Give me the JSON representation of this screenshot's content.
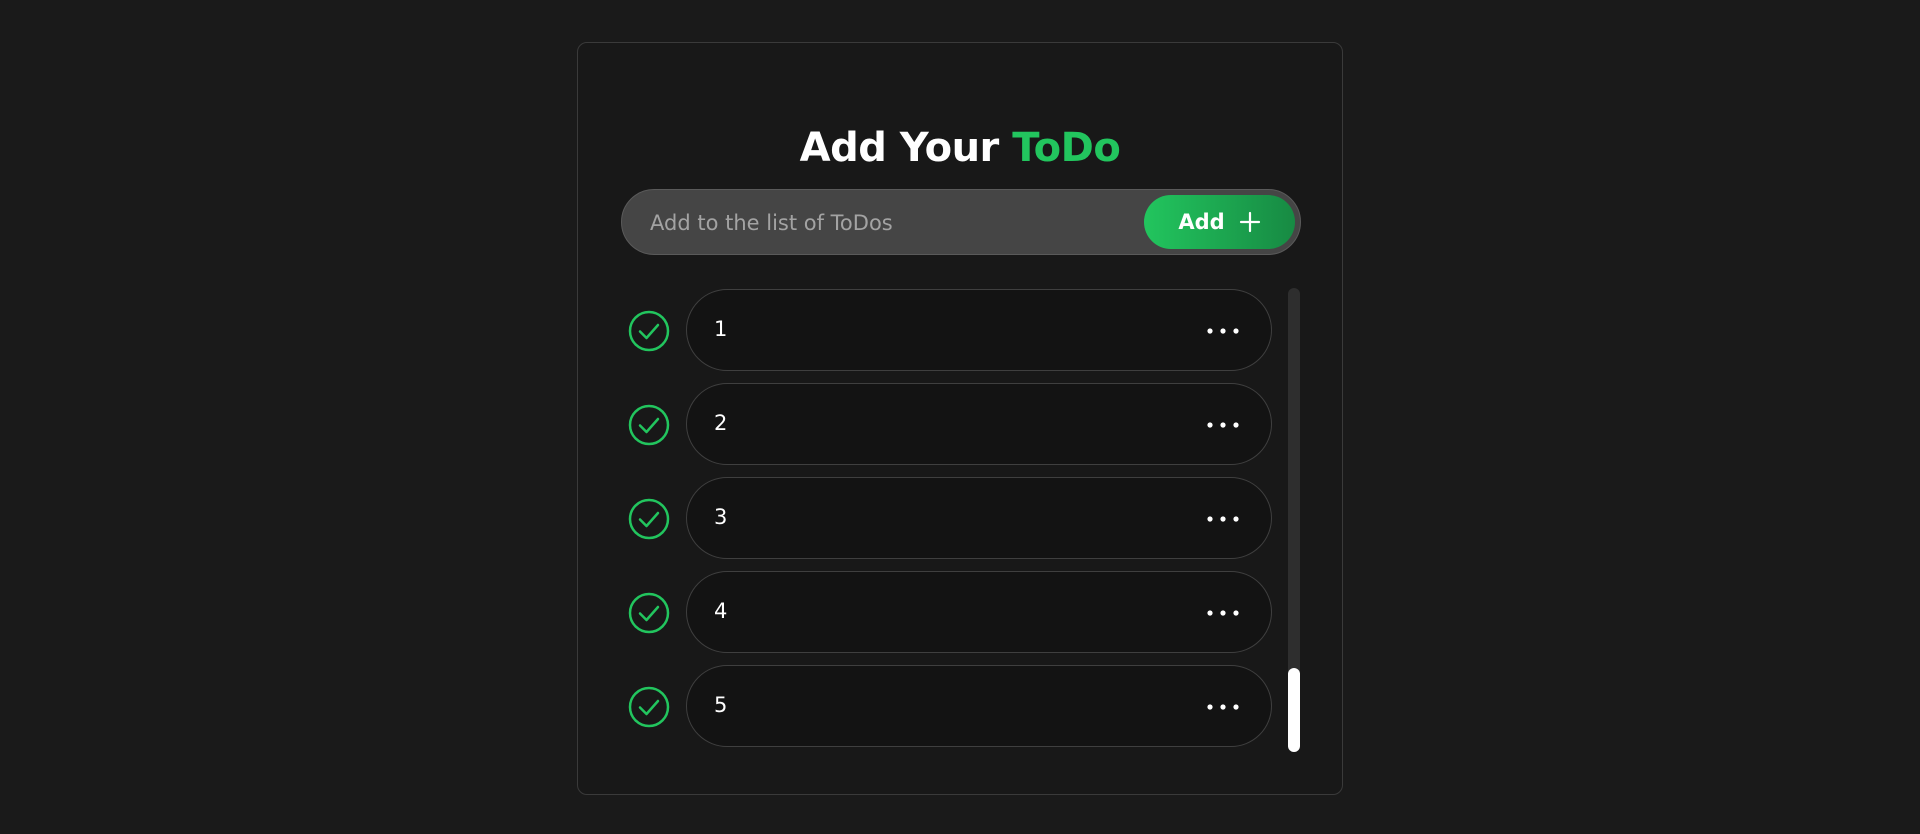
{
  "header": {
    "title_main": "Add Your ",
    "title_accent": "ToDo"
  },
  "input": {
    "placeholder": "Add to the list of ToDos",
    "value": ""
  },
  "add_button": {
    "label": "Add",
    "icon": "plus-icon"
  },
  "todos": [
    {
      "text": "1",
      "done": true
    },
    {
      "text": "2",
      "done": true
    },
    {
      "text": "3",
      "done": true
    },
    {
      "text": "4",
      "done": true
    },
    {
      "text": "5",
      "done": true
    }
  ],
  "scroll_position": "bottom",
  "colors": {
    "background": "#1a1a1a",
    "accent": "#22c55e",
    "accent_dark": "#178a43",
    "card_border": "#3a3a3a",
    "input_bg": "#454545",
    "item_bg": "#131313"
  }
}
